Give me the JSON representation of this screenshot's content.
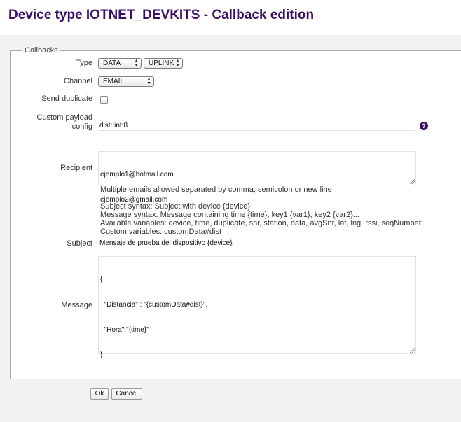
{
  "page": {
    "title": "Device type IOTNET_DEVKITS - Callback edition"
  },
  "form": {
    "legend": "Callbacks",
    "type_label": "Type",
    "type_value": "DATA",
    "direction_value": "UPLINK",
    "channel_label": "Channel",
    "channel_value": "EMAIL",
    "send_duplicate_label": "Send duplicate",
    "send_duplicate_checked": false,
    "custom_payload_label_line1": "Custom payload",
    "custom_payload_label_line2": "config",
    "custom_payload_value": "dist::int:8",
    "help_icon_glyph": "?",
    "recipient_label": "Recipient",
    "recipient_lines": [
      "ejemplo1@hotmail.com",
      "ejemplo2@gmail.com"
    ],
    "recipient_hint": "Multiple emails allowed separated by comma, semicolon or new line",
    "syntax_lines": [
      "Subject syntax: Subject with device {device}",
      "Message syntax: Message containing time {time}, key1 {var1}, key2 {var2}...",
      "Available variables: device, time, duplicate, snr, station, data, avgSnr, lat, lng, rssi, seqNumber",
      "Custom variables: customData#dist"
    ],
    "subject_label": "Subject",
    "subject_value": "Mensaje de prueba del dispositivo {device}",
    "message_label": "Message",
    "message_lines": [
      "{",
      "  \"Distancia\" : \"{customData#dist}\",",
      "  \"Hora\":\"{time}\"",
      "}"
    ]
  },
  "buttons": {
    "ok_label": "Ok",
    "cancel_label": "Cancel"
  },
  "icons": {
    "help": "question-circle-icon",
    "select_arrows": "updown-arrows-icon",
    "resize": "resize-grip-icon"
  },
  "colors": {
    "title": "#3b0f66",
    "help_icon": "#3b0f66",
    "background": "#f2f2f2"
  }
}
